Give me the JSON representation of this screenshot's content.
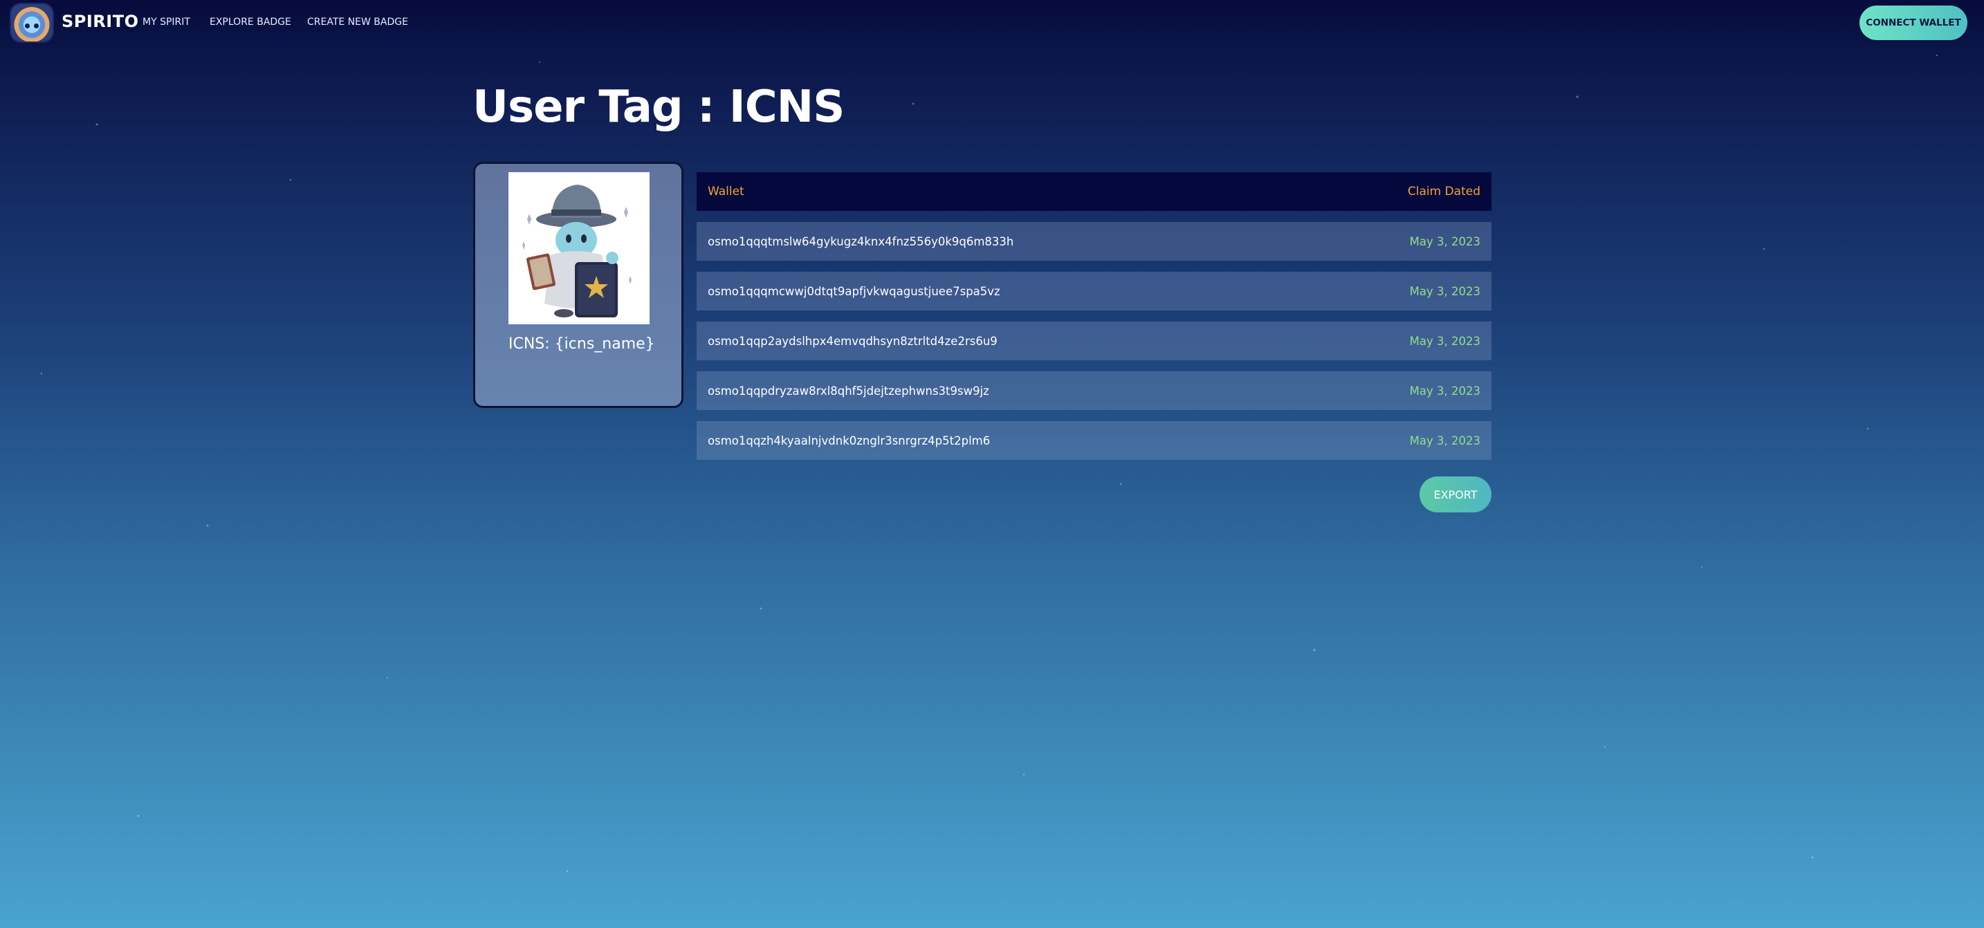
{
  "header": {
    "brand": "SPIRITO",
    "nav": [
      "MY SPIRIT",
      "EXPLORE BADGE",
      "CREATE NEW BADGE"
    ],
    "connect_label": "CONNECT WALLET"
  },
  "page": {
    "title": "User Tag : ICNS"
  },
  "badge": {
    "name": "ICNS: {icns_name}",
    "image_icon": "wizard-character-icon"
  },
  "table": {
    "headers": {
      "wallet": "Wallet",
      "date": "Claim Dated"
    },
    "rows": [
      {
        "wallet": "osmo1qqqtmslw64gykugz4knx4fnz556y0k9q6m833h",
        "date": "May 3, 2023"
      },
      {
        "wallet": "osmo1qqqmcwwj0dtqt9apfjvkwqagustjuee7spa5vz",
        "date": "May 3, 2023"
      },
      {
        "wallet": "osmo1qqp2aydslhpx4emvqdhsyn8ztrltd4ze2rs6u9",
        "date": "May 3, 2023"
      },
      {
        "wallet": "osmo1qqpdryzaw8rxl8qhf5jdejtzephwns3t9sw9jz",
        "date": "May 3, 2023"
      },
      {
        "wallet": "osmo1qqzh4kyaalnjvdnk0znglr3snrgrz4p5t2plm6",
        "date": "May 3, 2023"
      }
    ]
  },
  "actions": {
    "export_label": "EXPORT"
  },
  "colors": {
    "header_text": "#f0a530",
    "date_text": "#8fe08a",
    "accent_button": "#5cc9a6",
    "table_header_bg": "#05083d"
  }
}
